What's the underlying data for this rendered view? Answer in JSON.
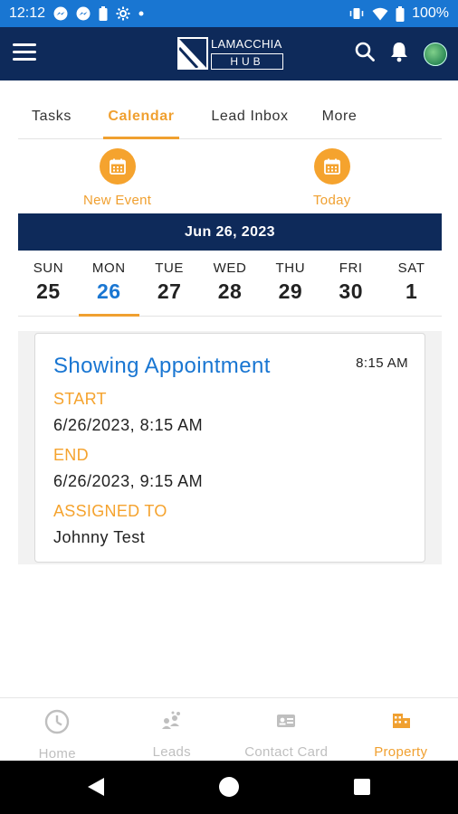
{
  "status_bar": {
    "time": "12:12",
    "battery": "100%"
  },
  "app_bar": {
    "logo_top": "LAMACCHIA",
    "logo_bottom": "HUB"
  },
  "tabs": [
    {
      "label": "Tasks",
      "active": false
    },
    {
      "label": "Calendar",
      "active": true
    },
    {
      "label": "Lead Inbox",
      "active": false
    },
    {
      "label": "More",
      "active": false
    }
  ],
  "quick_actions": {
    "new_event_label": "New Event",
    "today_label": "Today"
  },
  "date_banner": "Jun 26, 2023",
  "week": [
    {
      "name": "SUN",
      "num": "25"
    },
    {
      "name": "MON",
      "num": "26"
    },
    {
      "name": "TUE",
      "num": "27"
    },
    {
      "name": "WED",
      "num": "28"
    },
    {
      "name": "THU",
      "num": "29"
    },
    {
      "name": "FRI",
      "num": "30"
    },
    {
      "name": "SAT",
      "num": "1"
    }
  ],
  "event": {
    "title": "Showing Appointment",
    "time": "8:15 AM",
    "start_label": "START",
    "start_value": "6/26/2023, 8:15 AM",
    "end_label": "END",
    "end_value": "6/26/2023, 9:15 AM",
    "assigned_label": "ASSIGNED TO",
    "assigned_value": "Johnny Test"
  },
  "bottom_nav": [
    {
      "label": "Home",
      "icon": "clock-icon"
    },
    {
      "label": "Leads",
      "icon": "leads-icon"
    },
    {
      "label": "Contact Card",
      "icon": "contact-card-icon"
    },
    {
      "label": "Property",
      "icon": "property-icon"
    }
  ],
  "colors": {
    "accent": "#f0a030",
    "navy": "#0e2a5a",
    "link_blue": "#1976d2",
    "status_blue": "#1976d2"
  }
}
